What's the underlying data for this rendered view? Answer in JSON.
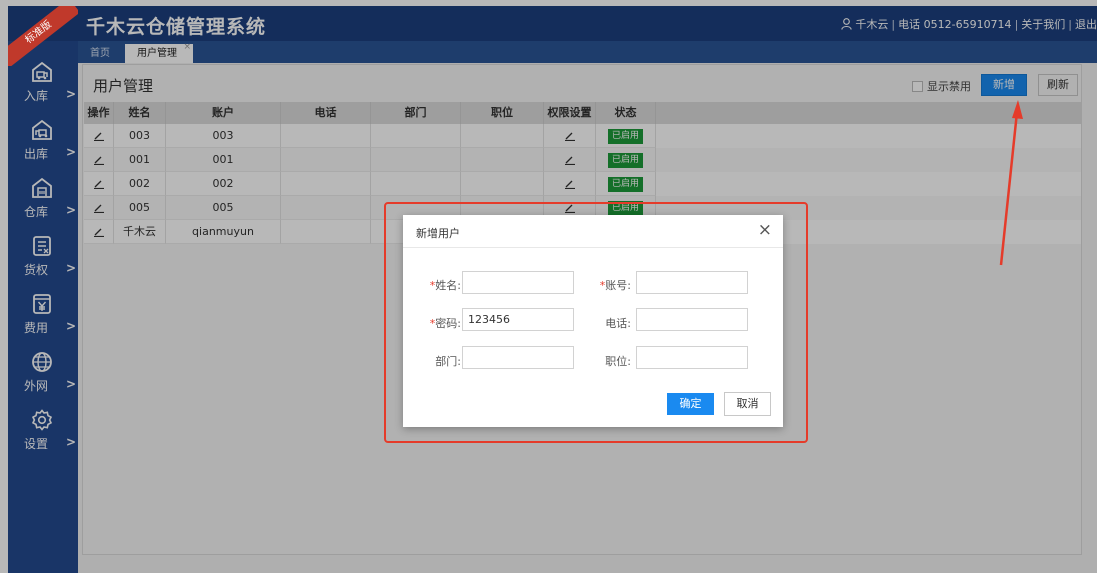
{
  "header": {
    "ribbon": "标准版",
    "title": "千木云仓储管理系统",
    "user": "千木云",
    "phone": "电话 0512-65910714",
    "about": "关于我们",
    "logout": "退出"
  },
  "sidebar": {
    "items": [
      {
        "label": "入库",
        "icon": "truck-warehouse-icon"
      },
      {
        "label": "出库",
        "icon": "truck-out-icon"
      },
      {
        "label": "仓库",
        "icon": "warehouse-icon"
      },
      {
        "label": "货权",
        "icon": "document-icon"
      },
      {
        "label": "费用",
        "icon": "yen-icon"
      },
      {
        "label": "外网",
        "icon": "globe-icon"
      },
      {
        "label": "设置",
        "icon": "gear-icon"
      }
    ],
    "arrow": ">"
  },
  "tabs": {
    "home": "首页",
    "active": "用户管理",
    "close": "×"
  },
  "page": {
    "title": "用户管理",
    "show_disabled": "显示禁用",
    "add_button": "新增",
    "refresh_button": "刷新"
  },
  "table": {
    "columns": [
      "操作",
      "姓名",
      "账户",
      "电话",
      "部门",
      "职位",
      "权限设置",
      "状态"
    ],
    "rows": [
      {
        "name": "003",
        "account": "003",
        "phone": "",
        "dept": "",
        "position": "",
        "status": "已启用"
      },
      {
        "name": "001",
        "account": "001",
        "phone": "",
        "dept": "",
        "position": "",
        "status": "已启用"
      },
      {
        "name": "002",
        "account": "002",
        "phone": "",
        "dept": "",
        "position": "",
        "status": "已启用"
      },
      {
        "name": "005",
        "account": "005",
        "phone": "",
        "dept": "",
        "position": "",
        "status": "已启用"
      },
      {
        "name": "千木云",
        "account": "qianmuyun",
        "phone": "",
        "dept": "",
        "position": "",
        "status": ""
      }
    ]
  },
  "dialog": {
    "title": "新增用户",
    "close": "×",
    "fields": {
      "name_label": "姓名:",
      "account_label": "账号:",
      "password_label": "密码:",
      "password_value": "123456",
      "phone_label": "电话:",
      "dept_label": "部门:",
      "position_label": "职位:"
    },
    "required_mark": "*",
    "ok": "确定",
    "cancel": "取消"
  },
  "colors": {
    "header_bg": "#1c3f7e",
    "sidebar_bg": "#234a8f",
    "accent_blue": "#1a8af0",
    "status_green": "#1d9a3a",
    "annotation_red": "#e53b2a"
  }
}
